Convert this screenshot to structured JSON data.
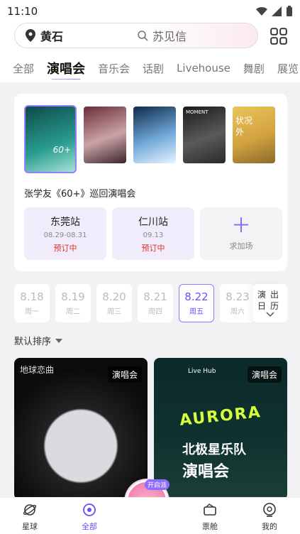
{
  "status": {
    "time": "11:10"
  },
  "search": {
    "city": "黄石",
    "placeholder": "苏见信"
  },
  "tabs": [
    "全部",
    "演唱会",
    "音乐会",
    "话剧",
    "Livehouse",
    "舞剧",
    "展览"
  ],
  "featured": {
    "title": "张学友《60+》巡回演唱会",
    "stations": [
      {
        "name": "东莞站",
        "date": "08.29-08.31",
        "status": "预订中"
      },
      {
        "name": "仁川站",
        "date": "09.13",
        "status": "预订中"
      }
    ],
    "add_label": "求加场",
    "poster_texts": [
      "60+",
      "MOMENT",
      "状况外"
    ]
  },
  "dates": [
    {
      "day": "8.18",
      "week": "周一"
    },
    {
      "day": "8.19",
      "week": "周二"
    },
    {
      "day": "8.20",
      "week": "周三"
    },
    {
      "day": "8.21",
      "week": "周四"
    },
    {
      "day": "8.22",
      "week": "周五"
    },
    {
      "day": "8.23",
      "week": "周六"
    }
  ],
  "calendar": {
    "line1": "演出",
    "line2": "日历"
  },
  "sort": {
    "label": "默认排序"
  },
  "cards": [
    {
      "badge": "演唱会",
      "text": "地球恋曲"
    },
    {
      "badge": "演唱会",
      "text1": "AURORA",
      "text2": "北极星乐队",
      "text3": "演唱会",
      "brand": "Live Hub"
    }
  ],
  "tabbar": {
    "items": [
      "星球",
      "全部",
      "票舱",
      "我的"
    ],
    "fab_tag": "开启派"
  },
  "colors": {
    "accent": "#6c4dff",
    "status_red": "#e0312a"
  }
}
